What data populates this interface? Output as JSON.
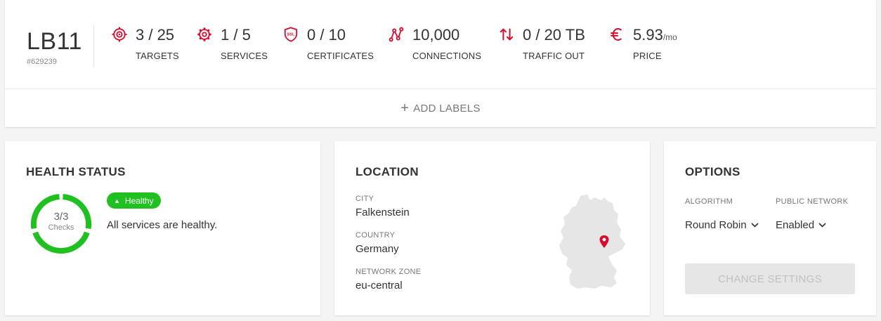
{
  "load_balancer": {
    "name": "LB11",
    "id": "#629239"
  },
  "stats": [
    {
      "icon": "target-icon",
      "value": "3 / 25",
      "label": "TARGETS"
    },
    {
      "icon": "gear-icon",
      "value": "1 / 5",
      "label": "SERVICES"
    },
    {
      "icon": "ssl-shield-icon",
      "value": "0 / 10",
      "label": "CERTIFICATES"
    },
    {
      "icon": "connections-icon",
      "value": "10,000",
      "label": "CONNECTIONS"
    },
    {
      "icon": "traffic-arrows-icon",
      "value": "0 / 20 TB",
      "label": "TRAFFIC OUT"
    },
    {
      "icon": "euro-icon",
      "value": "5.93",
      "unit": "/mo",
      "label": "PRICE"
    }
  ],
  "add_labels": {
    "label": "ADD LABELS"
  },
  "health": {
    "title": "HEALTH STATUS",
    "checks_value": "3/3",
    "checks_label": "Checks",
    "healthy_ratio": 1.0,
    "badge": "Healthy",
    "message": "All services are healthy."
  },
  "location": {
    "title": "LOCATION",
    "city_label": "CITY",
    "city": "Falkenstein",
    "country_label": "COUNTRY",
    "country": "Germany",
    "zone_label": "NETWORK ZONE",
    "zone": "eu-central"
  },
  "options": {
    "title": "OPTIONS",
    "algorithm_label": "ALGORITHM",
    "algorithm": "Round Robin",
    "network_label": "PUBLIC NETWORK",
    "network": "Enabled",
    "change_button": "CHANGE SETTINGS"
  },
  "colors": {
    "accent": "#d50c2d",
    "healthy": "#21c021",
    "muted": "#777777"
  }
}
